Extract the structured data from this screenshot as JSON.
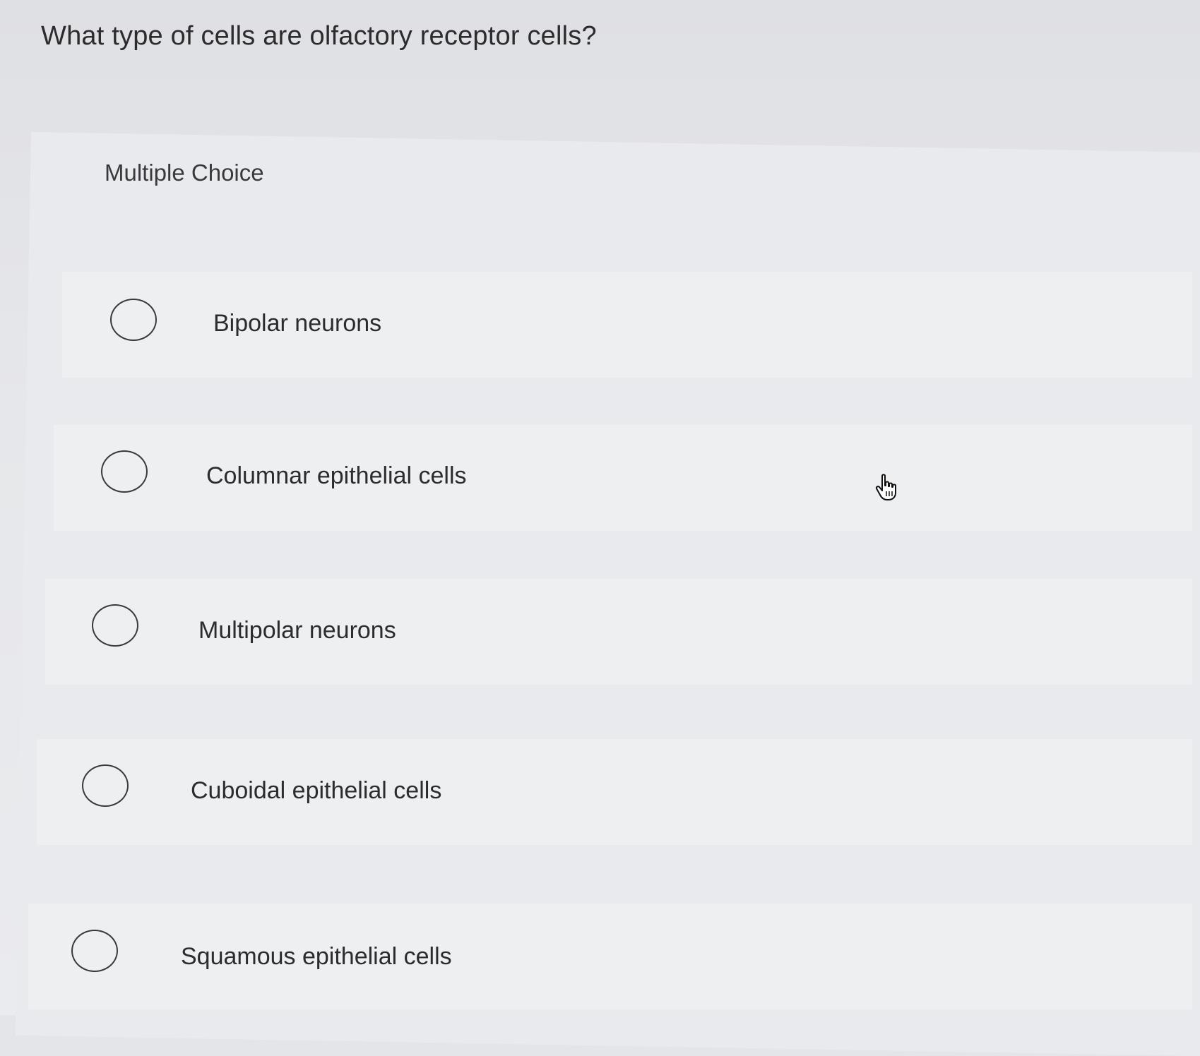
{
  "question": {
    "text": "What type of cells are olfactory receptor cells?"
  },
  "panel": {
    "label": "Multiple Choice"
  },
  "options": [
    {
      "label": "Bipolar neurons",
      "selected": false
    },
    {
      "label": "Columnar epithelial cells",
      "selected": false
    },
    {
      "label": "Multipolar neurons",
      "selected": false
    },
    {
      "label": "Cuboidal epithelial cells",
      "selected": false
    },
    {
      "label": "Squamous epithelial cells",
      "selected": false
    }
  ],
  "pointer": {
    "icon": "hand-pointer-icon"
  }
}
